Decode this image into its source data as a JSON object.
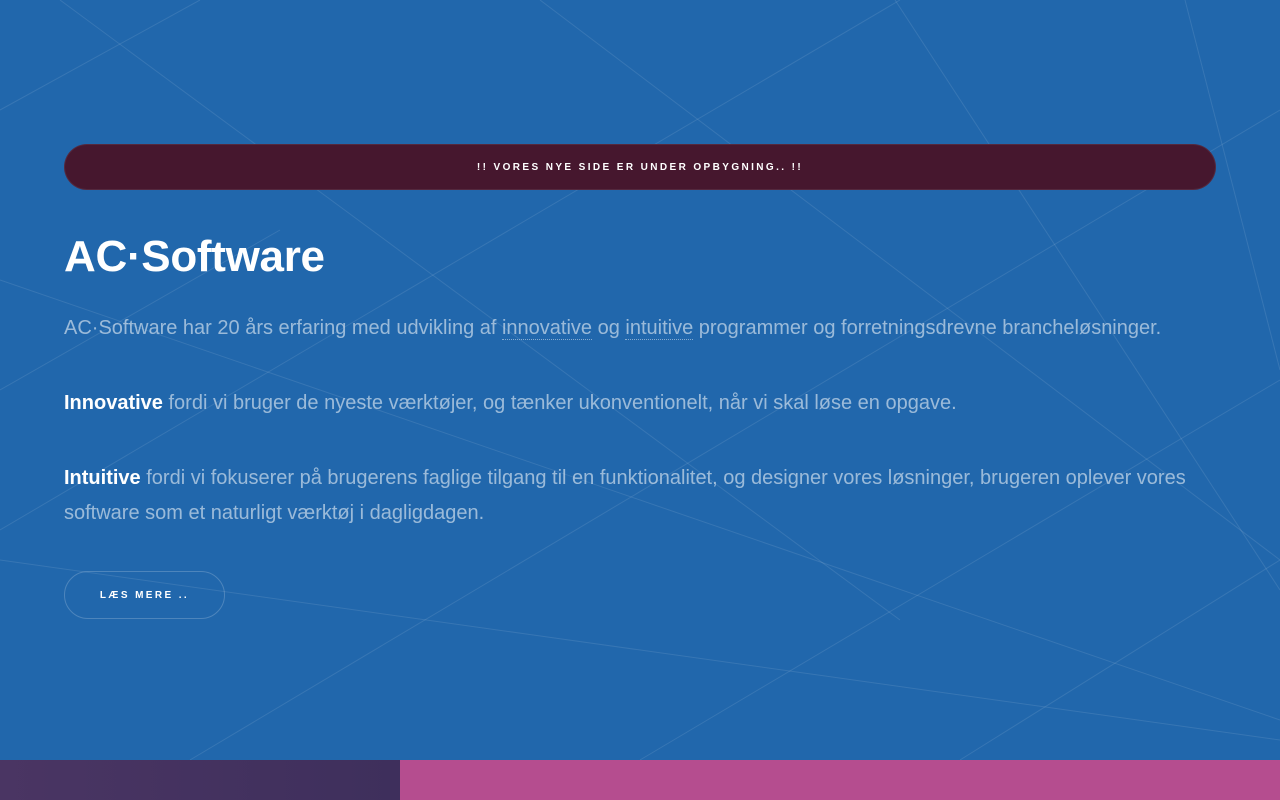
{
  "banner": {
    "text": "!! Vores nye side er under opbygning.. !!"
  },
  "hero": {
    "title": "AC·Software",
    "intro": {
      "before": "AC·Software har 20 års erfaring med udvikling af ",
      "link1": "innovative",
      "middle": " og ",
      "link2": "intuitive",
      "after": " programmer og forretningsdrevne brancheløsninger."
    },
    "innovative": {
      "label": "Innovative",
      "text": " fordi vi bruger de nyeste værktøjer, og tænker ukonventionelt, når vi skal løse en opgave."
    },
    "intuitive": {
      "label": "Intuitive",
      "text": " fordi vi fokuserer på brugerens faglige tilgang til en funktionalitet, og designer vores løsninger, brugeren oplever vores software som et naturligt værktøj i dagligdagen."
    },
    "read_more_label": "Læs mere .."
  },
  "colors": {
    "background": "#2167ac",
    "banner": "#46172e",
    "footer_left": "#3e2f5c",
    "footer_right": "#b54d8f"
  }
}
